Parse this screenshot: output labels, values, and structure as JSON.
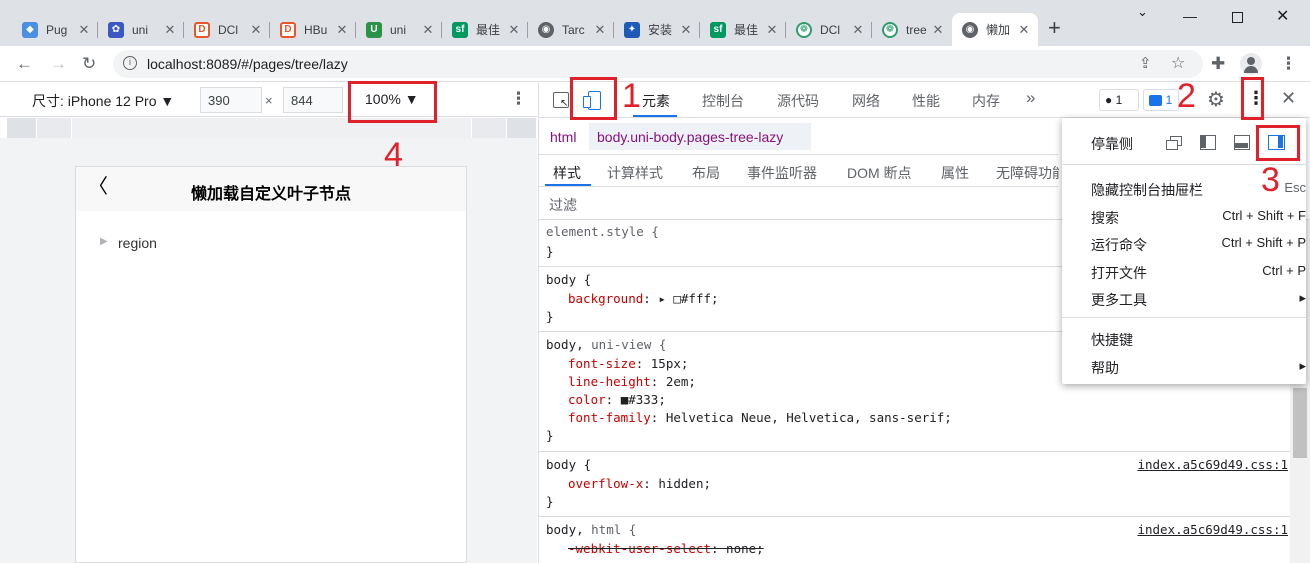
{
  "browser": {
    "tabs": [
      {
        "label": "Pug",
        "color": "#4a90e2",
        "glyph": "◆"
      },
      {
        "label": "uni",
        "color": "#3a57c4",
        "glyph": "✿"
      },
      {
        "label": "DCl",
        "color": "#e8572b",
        "glyph": "D"
      },
      {
        "label": "HBu",
        "color": "#e8572b",
        "glyph": "D"
      },
      {
        "label": "uni",
        "color": "#2b9348",
        "glyph": "U"
      },
      {
        "label": "最佳",
        "color": "#009a61",
        "glyph": "sf"
      },
      {
        "label": "Tarc",
        "color": "#5f6368",
        "glyph": "◉"
      },
      {
        "label": "安装",
        "color": "#1e5bb8",
        "glyph": "✦"
      },
      {
        "label": "最佳",
        "color": "#009a61",
        "glyph": "sf"
      },
      {
        "label": "DCl",
        "color": "#2e9e6e",
        "glyph": "❁"
      },
      {
        "label": "tree",
        "color": "#2e9e6e",
        "glyph": "❁"
      },
      {
        "label": "懒加",
        "color": "#5f6368",
        "glyph": "◉"
      }
    ],
    "new_tab": "+",
    "url": "localhost:8089/#/pages/tree/lazy"
  },
  "device_toolbar": {
    "size_label": "尺寸: iPhone 12 Pro ▼",
    "width": "390",
    "times": "×",
    "height": "844",
    "zoom": "100% ▼"
  },
  "page": {
    "back": "〈",
    "title": "懒加载自定义叶子节点",
    "tree_arrow": "▶",
    "tree_item": "region"
  },
  "devtools": {
    "tabs": [
      "元素",
      "控制台",
      "源代码",
      "网络",
      "性能",
      "内存"
    ],
    "more": "»",
    "errors_badge": "● 1",
    "messages_badge": "1",
    "breadcrumb": [
      "html",
      "body.uni-body.pages-tree-lazy"
    ],
    "subtabs": [
      "样式",
      "计算样式",
      "布局",
      "事件监听器",
      "DOM 断点",
      "属性",
      "无障碍功能"
    ],
    "filter": "过滤",
    "rules": [
      {
        "selector": "element.style {",
        "lines": [],
        "close": "}"
      },
      {
        "selector": "body {",
        "lines": [
          [
            "background",
            ": ▸ □#fff;"
          ]
        ],
        "close": "}"
      },
      {
        "selector": "body, uni-view {",
        "lines": [
          [
            "font-size",
            ": 15px;"
          ],
          [
            "line-height",
            ": 2em;"
          ],
          [
            "color",
            ": ■#333;"
          ],
          [
            "font-family",
            ": Helvetica Neue, Helvetica, sans-serif;"
          ]
        ],
        "close": "}"
      },
      {
        "selector": "body {",
        "source": "index.a5c69d49.css:1",
        "lines": [
          [
            "overflow-x",
            ": hidden;"
          ]
        ],
        "close": "}"
      },
      {
        "selector": "body, html {",
        "source": "index.a5c69d49.css:1",
        "lines": [
          [
            "-webkit-user-select",
            ": none;"
          ]
        ],
        "close": ""
      }
    ]
  },
  "menu": {
    "dock_label": "停靠侧",
    "items": [
      {
        "label": "隐藏控制台抽屉栏",
        "shortcut": "Esc"
      },
      {
        "label": "搜索",
        "shortcut": "Ctrl + Shift + F"
      },
      {
        "label": "运行命令",
        "shortcut": "Ctrl + Shift + P"
      },
      {
        "label": "打开文件",
        "shortcut": "Ctrl + P"
      },
      {
        "label": "更多工具",
        "shortcut": "▸"
      },
      {
        "label": "快捷键",
        "shortcut": ""
      },
      {
        "label": "帮助",
        "shortcut": "▸"
      }
    ]
  },
  "annotations": [
    "1",
    "2",
    "3",
    "4"
  ],
  "colors": {
    "annotation": "#e0202a",
    "accent": "#1a73e8",
    "css_property": "#c80000"
  }
}
